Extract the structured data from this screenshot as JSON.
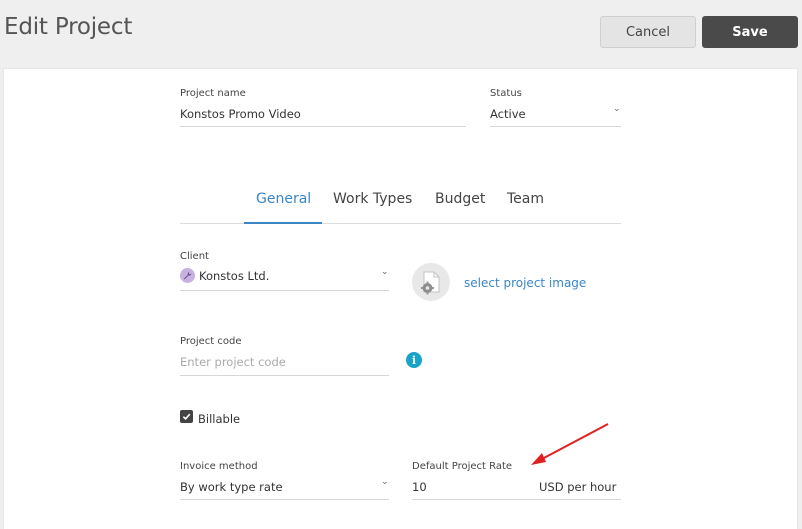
{
  "header": {
    "title": "Edit Project",
    "cancel_label": "Cancel",
    "save_label": "Save"
  },
  "form": {
    "project_name": {
      "label": "Project name",
      "value": "Konstos Promo Video"
    },
    "status": {
      "label": "Status",
      "value": "Active"
    },
    "tabs": [
      {
        "label": "General",
        "active": true
      },
      {
        "label": "Work Types",
        "active": false
      },
      {
        "label": "Budget",
        "active": false
      },
      {
        "label": "Team",
        "active": false
      }
    ],
    "client": {
      "label": "Client",
      "value": "Konstos Ltd.",
      "icon": "wrench-icon"
    },
    "project_image": {
      "link_label": "select project image",
      "icon": "file-gear-icon"
    },
    "project_code": {
      "label": "Project code",
      "placeholder": "Enter project code",
      "icon": "info-icon"
    },
    "billable": {
      "label": "Billable",
      "checked": true
    },
    "invoice_method": {
      "label": "Invoice method",
      "value": "By work type rate"
    },
    "default_rate": {
      "label": "Default Project Rate",
      "value": "10",
      "unit": "USD per hour"
    }
  },
  "colors": {
    "accent": "#3b86c6",
    "save_button": "#4a4a4a",
    "info_icon": "#1aa3c8",
    "annotation_arrow": "#e02020"
  }
}
